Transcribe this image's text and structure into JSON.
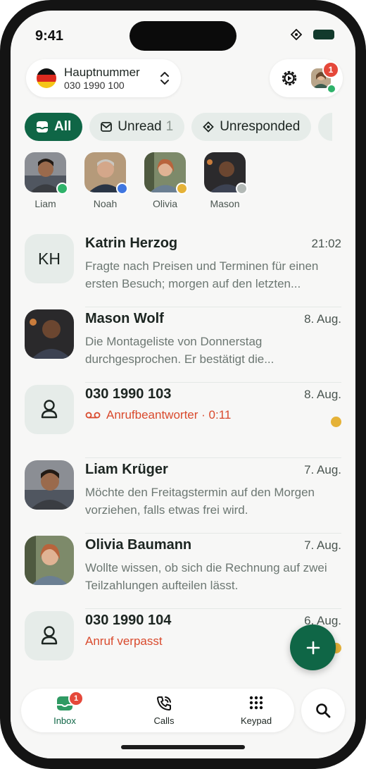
{
  "status": {
    "time": "9:41"
  },
  "number": {
    "title": "Hauptnummer",
    "sub": "030 1990 100"
  },
  "account": {
    "badge": "1"
  },
  "filters": {
    "all": "All",
    "unread": "Unread",
    "unread_count": "1",
    "unresponded": "Unresponded"
  },
  "stories": [
    {
      "name": "Liam",
      "status_color": "#2fb26a"
    },
    {
      "name": "Noah",
      "status_color": "#3f76e0"
    },
    {
      "name": "Olivia",
      "status_color": "#e5b237"
    },
    {
      "name": "Mason",
      "status_color": "#b3b9b6"
    }
  ],
  "conversations": [
    {
      "name": "Katrin Herzog",
      "initials": "KH",
      "date": "21:02",
      "preview": "Fragte nach Preisen und Terminen für einen ersten Besuch; morgen auf den letzten..."
    },
    {
      "name": "Mason Wolf",
      "date": "8. Aug.",
      "preview": "Die Montageliste von Donnerstag durchgesprochen. Er bestätigt die..."
    },
    {
      "name": "030 1990 103",
      "date": "8. Aug.",
      "status_text": "Anrufbeantworter · 0:11"
    },
    {
      "name": "Liam Krüger",
      "date": "7. Aug.",
      "preview": "Möchte den Freitagstermin auf den Morgen vorziehen, falls etwas frei wird."
    },
    {
      "name": "Olivia Baumann",
      "date": "7. Aug.",
      "preview": "Wollte wissen, ob sich die Rechnung auf zwei Teilzahlungen aufteilen lässt."
    },
    {
      "name": "030 1990 104",
      "date": "6. Aug.",
      "status_text": "Anruf verpasst"
    }
  ],
  "tabs": {
    "inbox": "Inbox",
    "inbox_badge": "1",
    "calls": "Calls",
    "keypad": "Keypad"
  },
  "colors": {
    "accent": "#0f6646",
    "badge": "#e5483a",
    "missed": "#d94a2d",
    "unread_dot": "#e5b237"
  }
}
